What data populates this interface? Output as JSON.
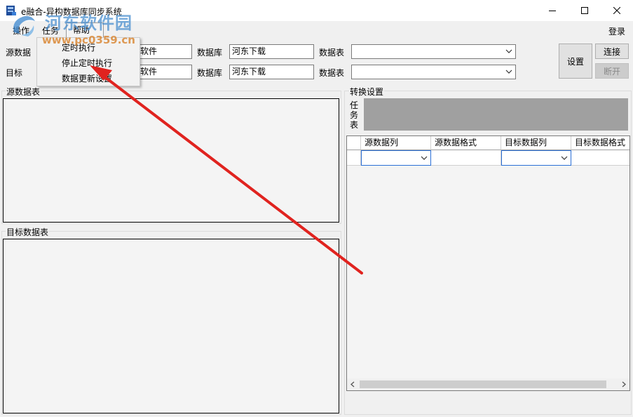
{
  "window": {
    "title": "e融合-异构数据库同步系统",
    "controls": [
      "minimize-icon",
      "maximize-icon",
      "close-icon"
    ]
  },
  "watermark": {
    "brand": "河东软件园",
    "url": "www.pc0359.cn"
  },
  "menubar": {
    "items": [
      "操作",
      "任务",
      "帮助"
    ],
    "login": "登录"
  },
  "dropdown": {
    "items": [
      "定时执行",
      "停止定时执行",
      "数据更新设置"
    ]
  },
  "source_row": {
    "label": "源数据",
    "server_value": "软件",
    "db_label": "数据库",
    "db_value": "河东下载",
    "table_label": "数据表",
    "table_value": ""
  },
  "target_row": {
    "label": "目标",
    "server_value": "软件",
    "db_label": "数据库",
    "db_value": "河东下载",
    "table_label": "数据表",
    "table_value": ""
  },
  "buttons": {
    "settings": "设置",
    "connect": "连接",
    "disconnect": "断开"
  },
  "groups": {
    "source_table": "源数据表",
    "target_table": "目标数据表",
    "conversion": "转换设置",
    "task_table": "任务表"
  },
  "grid": {
    "columns": [
      "源数据列",
      "源数据格式",
      "目标数据列",
      "目标数据格式"
    ],
    "rows": [
      [
        "",
        "",
        "",
        ""
      ]
    ]
  },
  "colors": {
    "arrow": "#e0231f",
    "watermark_brand": "#4a8fcf",
    "watermark_url": "#d9822b",
    "task_list_bg": "#a0a0a0"
  }
}
